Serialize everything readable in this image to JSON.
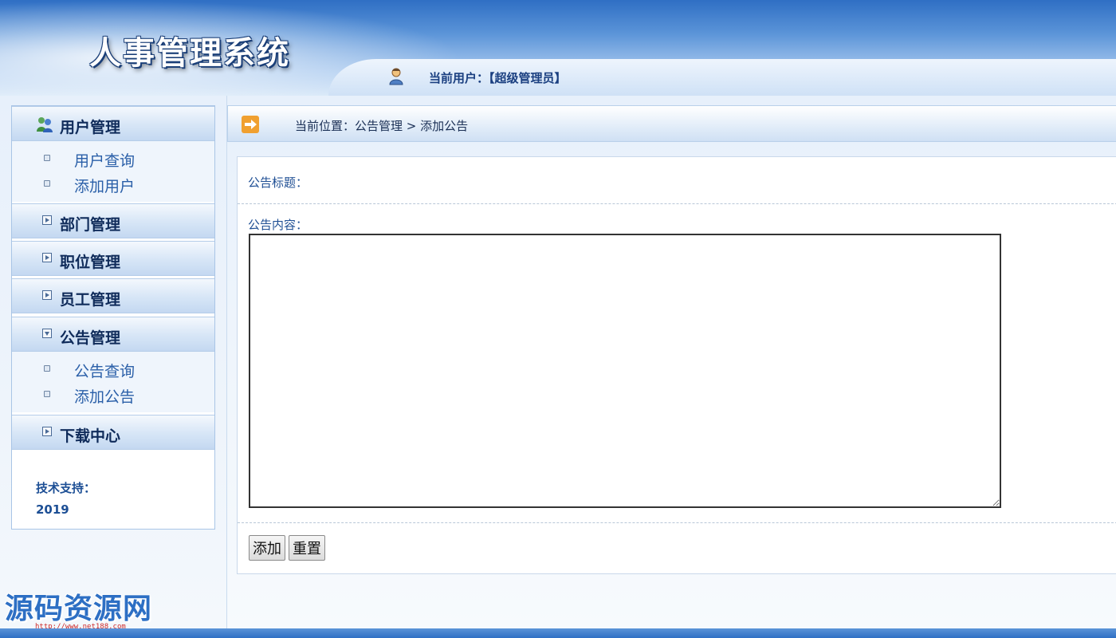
{
  "header": {
    "app_title": "人事管理系统",
    "current_user_label": "当前用户：【超级管理员】"
  },
  "sidebar": {
    "sections": [
      {
        "label": "用户管理",
        "items": [
          "用户查询",
          "添加用户"
        ]
      },
      {
        "label": "部门管理"
      },
      {
        "label": "职位管理"
      },
      {
        "label": "员工管理"
      },
      {
        "label": "公告管理",
        "items": [
          "公告查询",
          "添加公告"
        ]
      },
      {
        "label": "下载中心"
      }
    ],
    "support_label": "技术支持：",
    "support_year": "2019"
  },
  "breadcrumb": "当前位置：公告管理 > 添加公告",
  "form": {
    "title_label": "公告标题：",
    "title_value": "",
    "content_label": "公告内容：",
    "content_value": "",
    "add_button": "添加",
    "reset_button": "重置"
  },
  "watermark": {
    "text": "源码资源网",
    "url": "http://www.net188.com"
  },
  "colors": {
    "header_blue": "#2f6fc4",
    "link_blue": "#2a5fa8",
    "label_blue": "#1f4f94",
    "breadcrumb_icon_orange": "#f0a030"
  },
  "icons": [
    "user-icon",
    "users-icon",
    "arrow-right-icon",
    "expand-icon",
    "collapse-icon",
    "bullet-icon"
  ]
}
